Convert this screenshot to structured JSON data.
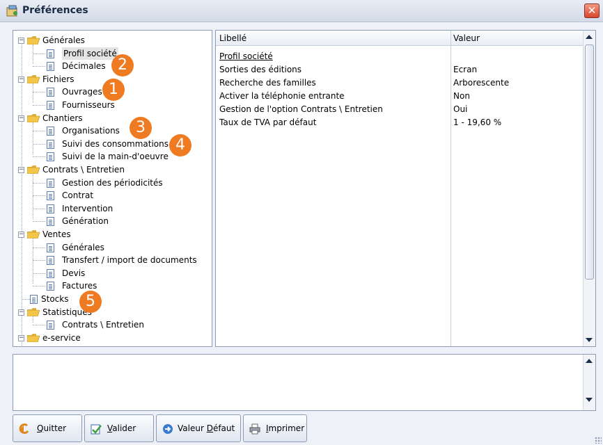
{
  "window": {
    "title": "Préférences",
    "close_glyph": "✕"
  },
  "tree": {
    "groups": [
      {
        "label": "Générales",
        "items": [
          "Profil société",
          "Décimales"
        ]
      },
      {
        "label": "Fichiers",
        "items": [
          "Ouvrages",
          "Fournisseurs"
        ]
      },
      {
        "label": "Chantiers",
        "items": [
          "Organisations",
          "Suivi des consommations",
          "Suivi de la main-d'oeuvre"
        ]
      },
      {
        "label": "Contrats \\ Entretien",
        "items": [
          "Gestion des périodicités",
          "Contrat",
          "Intervention",
          "Génération"
        ]
      },
      {
        "label": "Ventes",
        "items": [
          "Générales",
          "Transfert / import de documents",
          "Devis",
          "Factures"
        ]
      },
      {
        "label": "Stocks",
        "items": []
      },
      {
        "label": "Statistiques",
        "items": [
          "Contrats \\ Entretien"
        ]
      },
      {
        "label": "e-service",
        "items": []
      }
    ],
    "selected": "Profil société"
  },
  "badges": [
    "1",
    "2",
    "3",
    "4",
    "5"
  ],
  "grid": {
    "headers": {
      "label": "Libellé",
      "value": "Valeur"
    },
    "section_title": "Profil société",
    "rows": [
      {
        "label": "Sorties des éditions",
        "value": "Ecran"
      },
      {
        "label": "Recherche des familles",
        "value": "Arborescente"
      },
      {
        "label": "Activer la téléphonie entrante",
        "value": "Non"
      },
      {
        "label": "Gestion de l'option Contrats \\ Entretien",
        "value": "Oui"
      },
      {
        "label": "Taux de TVA par défaut",
        "value": "1 - 19,60 %"
      }
    ]
  },
  "description": "",
  "buttons": {
    "quit": {
      "pre": "",
      "key": "Q",
      "post": "uitter"
    },
    "validate": {
      "pre": "",
      "key": "V",
      "post": "alider"
    },
    "default": {
      "pre": "Valeur ",
      "key": "D",
      "post": "éfaut"
    },
    "print": {
      "pre": "",
      "key": "I",
      "post": "mprimer"
    }
  },
  "colors": {
    "badge": "#ee7b22",
    "close": "#d9452e",
    "folder": "#f3c64a"
  }
}
